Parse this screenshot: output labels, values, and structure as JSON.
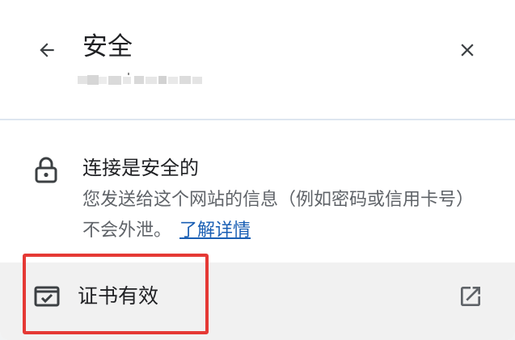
{
  "header": {
    "back_icon": "arrow-left-icon",
    "title": "安全",
    "close_icon": "close-icon"
  },
  "connection": {
    "lock_icon": "lock-icon",
    "title": "连接是安全的",
    "description": "您发送给这个网站的信息（例如密码或信用卡号）不会外泄。",
    "learn_more": "了解详情"
  },
  "certificate": {
    "icon": "certificate-icon",
    "label": "证书有效",
    "external_icon": "open-in-new-icon"
  },
  "colors": {
    "link": "#1a5fb4",
    "highlight": "#e53935",
    "row_background": "#f1f1f1"
  }
}
